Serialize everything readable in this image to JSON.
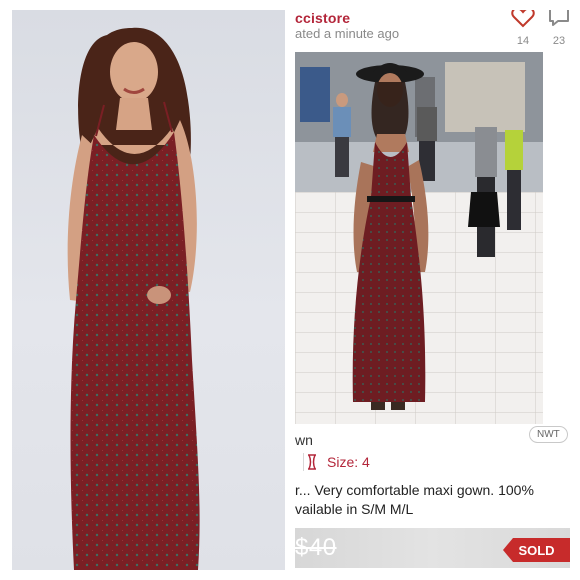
{
  "listing": {
    "seller_name": "ccistore",
    "updated_text": "ated a minute ago",
    "likes_count": "14",
    "comments_count": "23",
    "title": "wn",
    "badge": "NWT",
    "size_label": "Size: 4",
    "description_line1": "r... Very comfortable maxi gown. 100%",
    "description_line2": "vailable in S/M M/L",
    "price": "$40",
    "status": "SOLD",
    "icons": [
      "heart-icon",
      "comment-icon",
      "size-tag-icon"
    ]
  },
  "colors": {
    "brand": "#b3263a",
    "sold": "#c72b2b",
    "dress": "#7a1f24"
  }
}
